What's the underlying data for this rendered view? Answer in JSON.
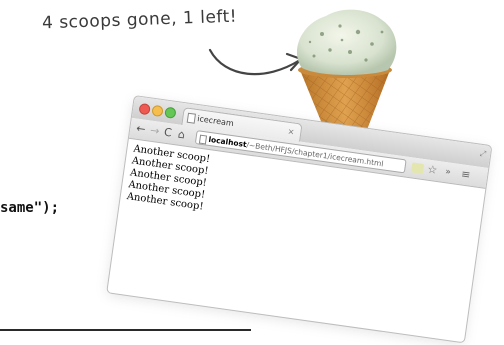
{
  "annotation": {
    "text": "4 scoops gone, 1 left!"
  },
  "code_fragment": {
    "text": "same\");"
  },
  "browser": {
    "tab_title": "icecream",
    "tab_close": "×",
    "url_host": "localhost",
    "url_path": "/~Beth/HFJS/chapter1/icecream.html",
    "nav": {
      "back": "←",
      "forward": "→",
      "reload": "C",
      "home": "⌂"
    },
    "toolbar_right": {
      "star": "☆",
      "more": "»",
      "menu": "≡"
    },
    "content_lines": [
      "Another scoop!",
      "Another scoop!",
      "Another scoop!",
      "Another scoop!",
      "Another scoop!"
    ]
  },
  "colors": {
    "window_border": "#bdbdbd",
    "close": "#ee5a52",
    "minimize": "#f5be4f",
    "zoom": "#63c655"
  },
  "icons": [
    "arrow-icon",
    "ice-cream-cone-icon",
    "document-icon",
    "star-icon",
    "menu-icon"
  ]
}
